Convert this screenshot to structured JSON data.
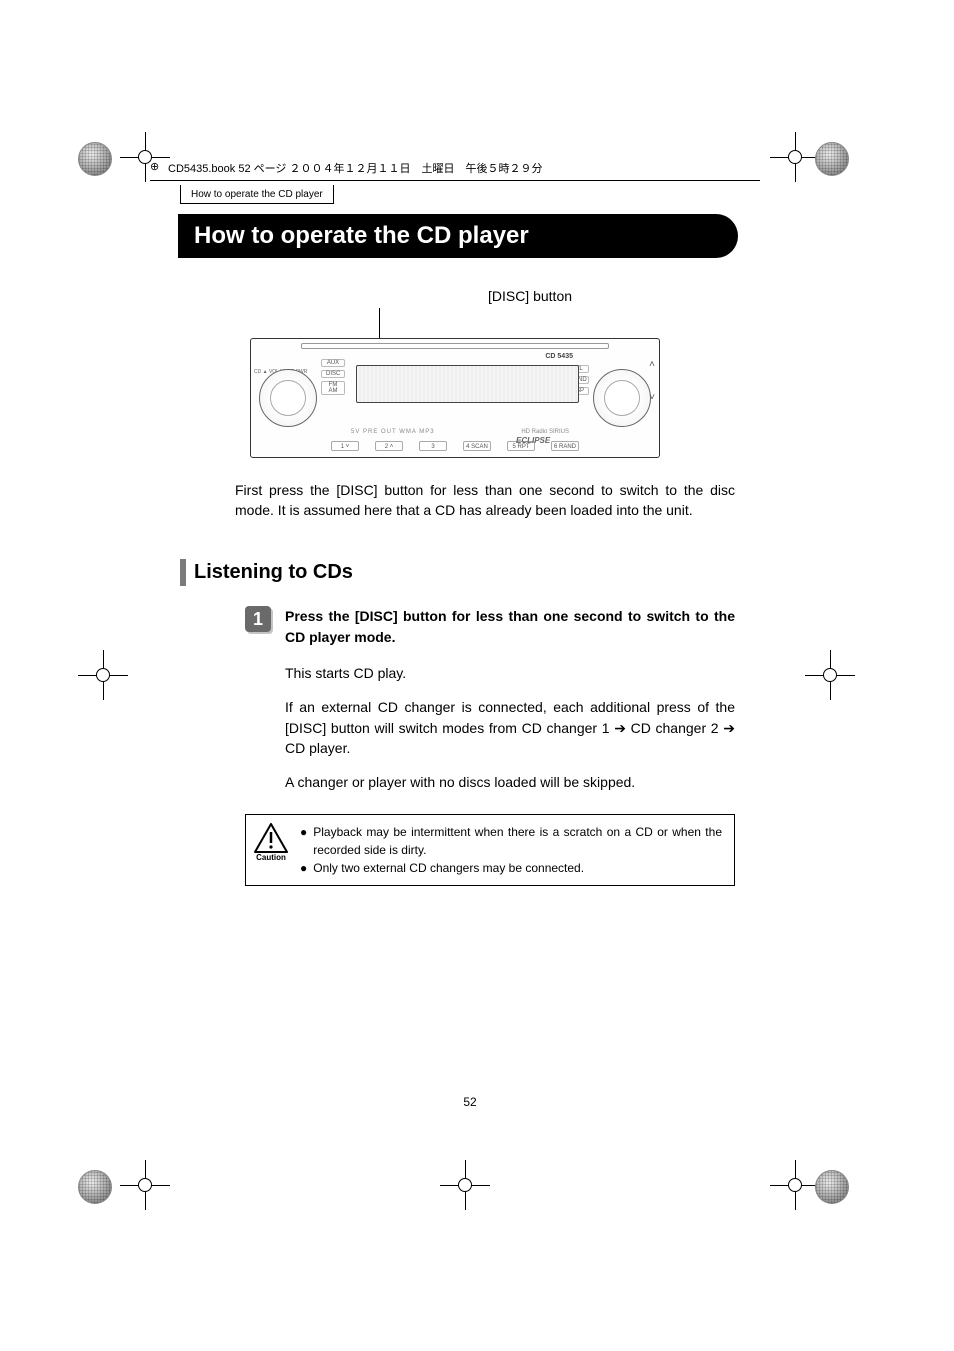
{
  "meta_line": "CD5435.book  52 ページ  ２００４年１２月１１日　土曜日　午後５時２９分",
  "breadcrumb": "How to operate the CD player",
  "title": "How to operate the CD player",
  "button_label": "[DISC] button",
  "device": {
    "model": "CD 5435",
    "brand_center": "ECLIPSE",
    "bottom_btns_left": [
      "1  ˅",
      "2  ˄",
      "3"
    ],
    "bottom_btns_right": [
      "4 SCAN",
      "5 RPT",
      "6 RAND"
    ],
    "side_left": [
      "AUX",
      "DISC",
      "FM AM"
    ],
    "side_right": [
      "SEL",
      "BAND",
      "DISP"
    ],
    "left_labels": "CD ▲  VOL  MUTE  PWR",
    "logos_left": "5V PRE OUT  WMA  MP3",
    "logos_right": "HD Radio   SIRIUS"
  },
  "intro": "First press the [DISC] button for less than one second to switch to the disc mode.  It is assumed here that a CD has already been loaded into the unit.",
  "section_heading": "Listening to CDs",
  "step1": {
    "num": "1",
    "heading": "Press the [DISC] button for less than one second to switch to the CD player mode.",
    "p1": "This starts CD play.",
    "p2": "If an external CD changer is connected, each additional press of the [DISC] button will switch modes from CD changer 1 ➔ CD changer 2 ➔ CD player.",
    "p3": "A changer or player with no discs loaded will be skipped."
  },
  "caution": {
    "label": "Caution",
    "notes": [
      "Playback may be intermittent when there is a scratch on a CD or when the recorded side is dirty.",
      "Only two external CD changers may be connected."
    ]
  },
  "page_number": "52"
}
